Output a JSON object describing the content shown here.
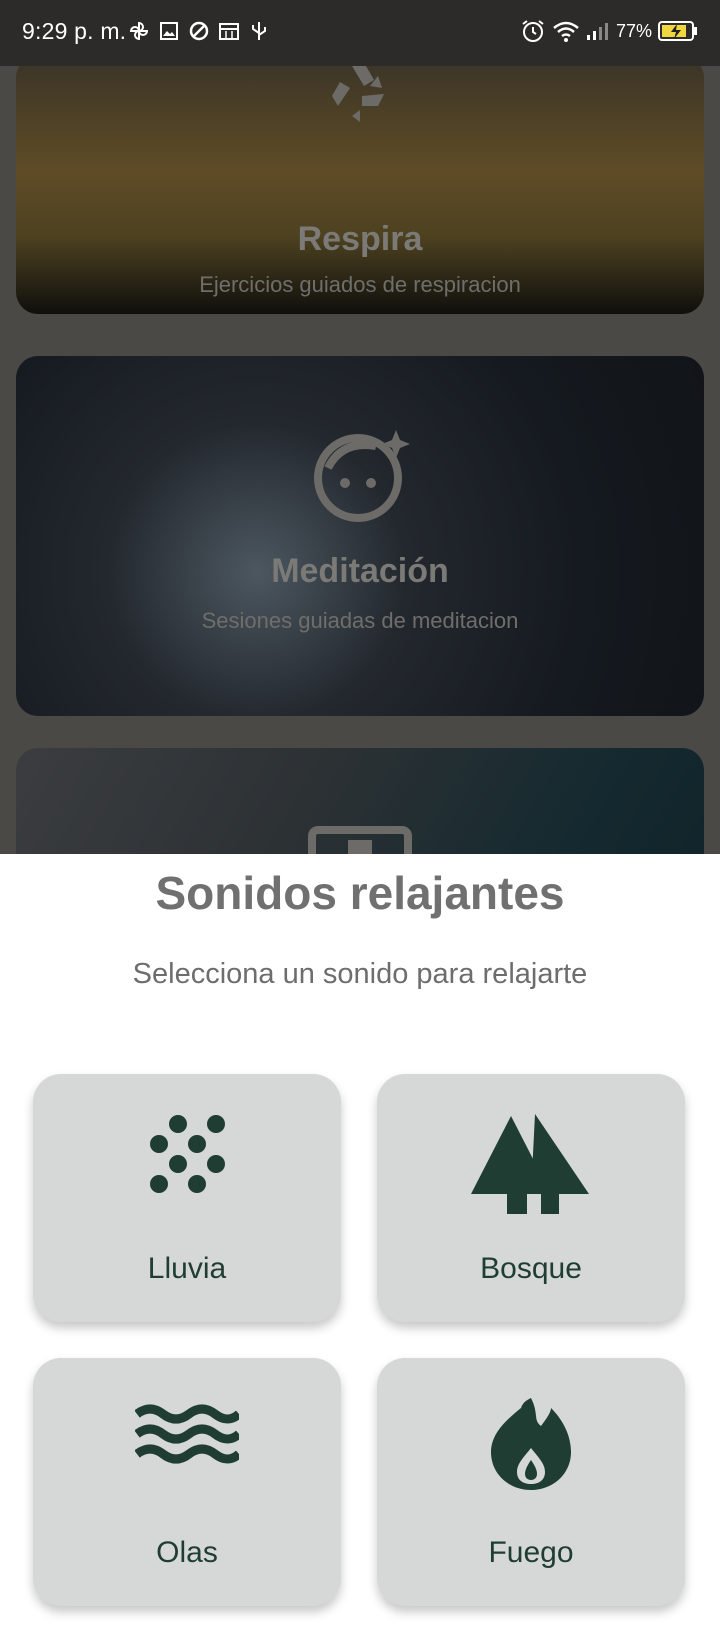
{
  "status_bar": {
    "time": "9:29 p. m.",
    "battery": "77%"
  },
  "cards": [
    {
      "title": "Respira",
      "subtitle": "Ejercicios guiados de respiracion",
      "icon": "recycle-icon"
    },
    {
      "title": "Meditación",
      "subtitle": "Sesiones guiadas de meditacion",
      "icon": "face-sparkle-icon"
    },
    {
      "title": "",
      "subtitle": "",
      "icon": "tv-icon"
    }
  ],
  "sheet": {
    "title": "Sonidos relajantes",
    "subtitle": "Selecciona un sonido para relajarte",
    "sounds": [
      {
        "label": "Lluvia",
        "icon": "rain-dots-icon"
      },
      {
        "label": "Bosque",
        "icon": "forest-icon"
      },
      {
        "label": "Olas",
        "icon": "waves-icon"
      },
      {
        "label": "Fuego",
        "icon": "fire-icon"
      }
    ]
  },
  "colors": {
    "accent": "#1f3d33",
    "tile_bg": "#d5d8d6",
    "status_bar": "#2c2b29"
  }
}
